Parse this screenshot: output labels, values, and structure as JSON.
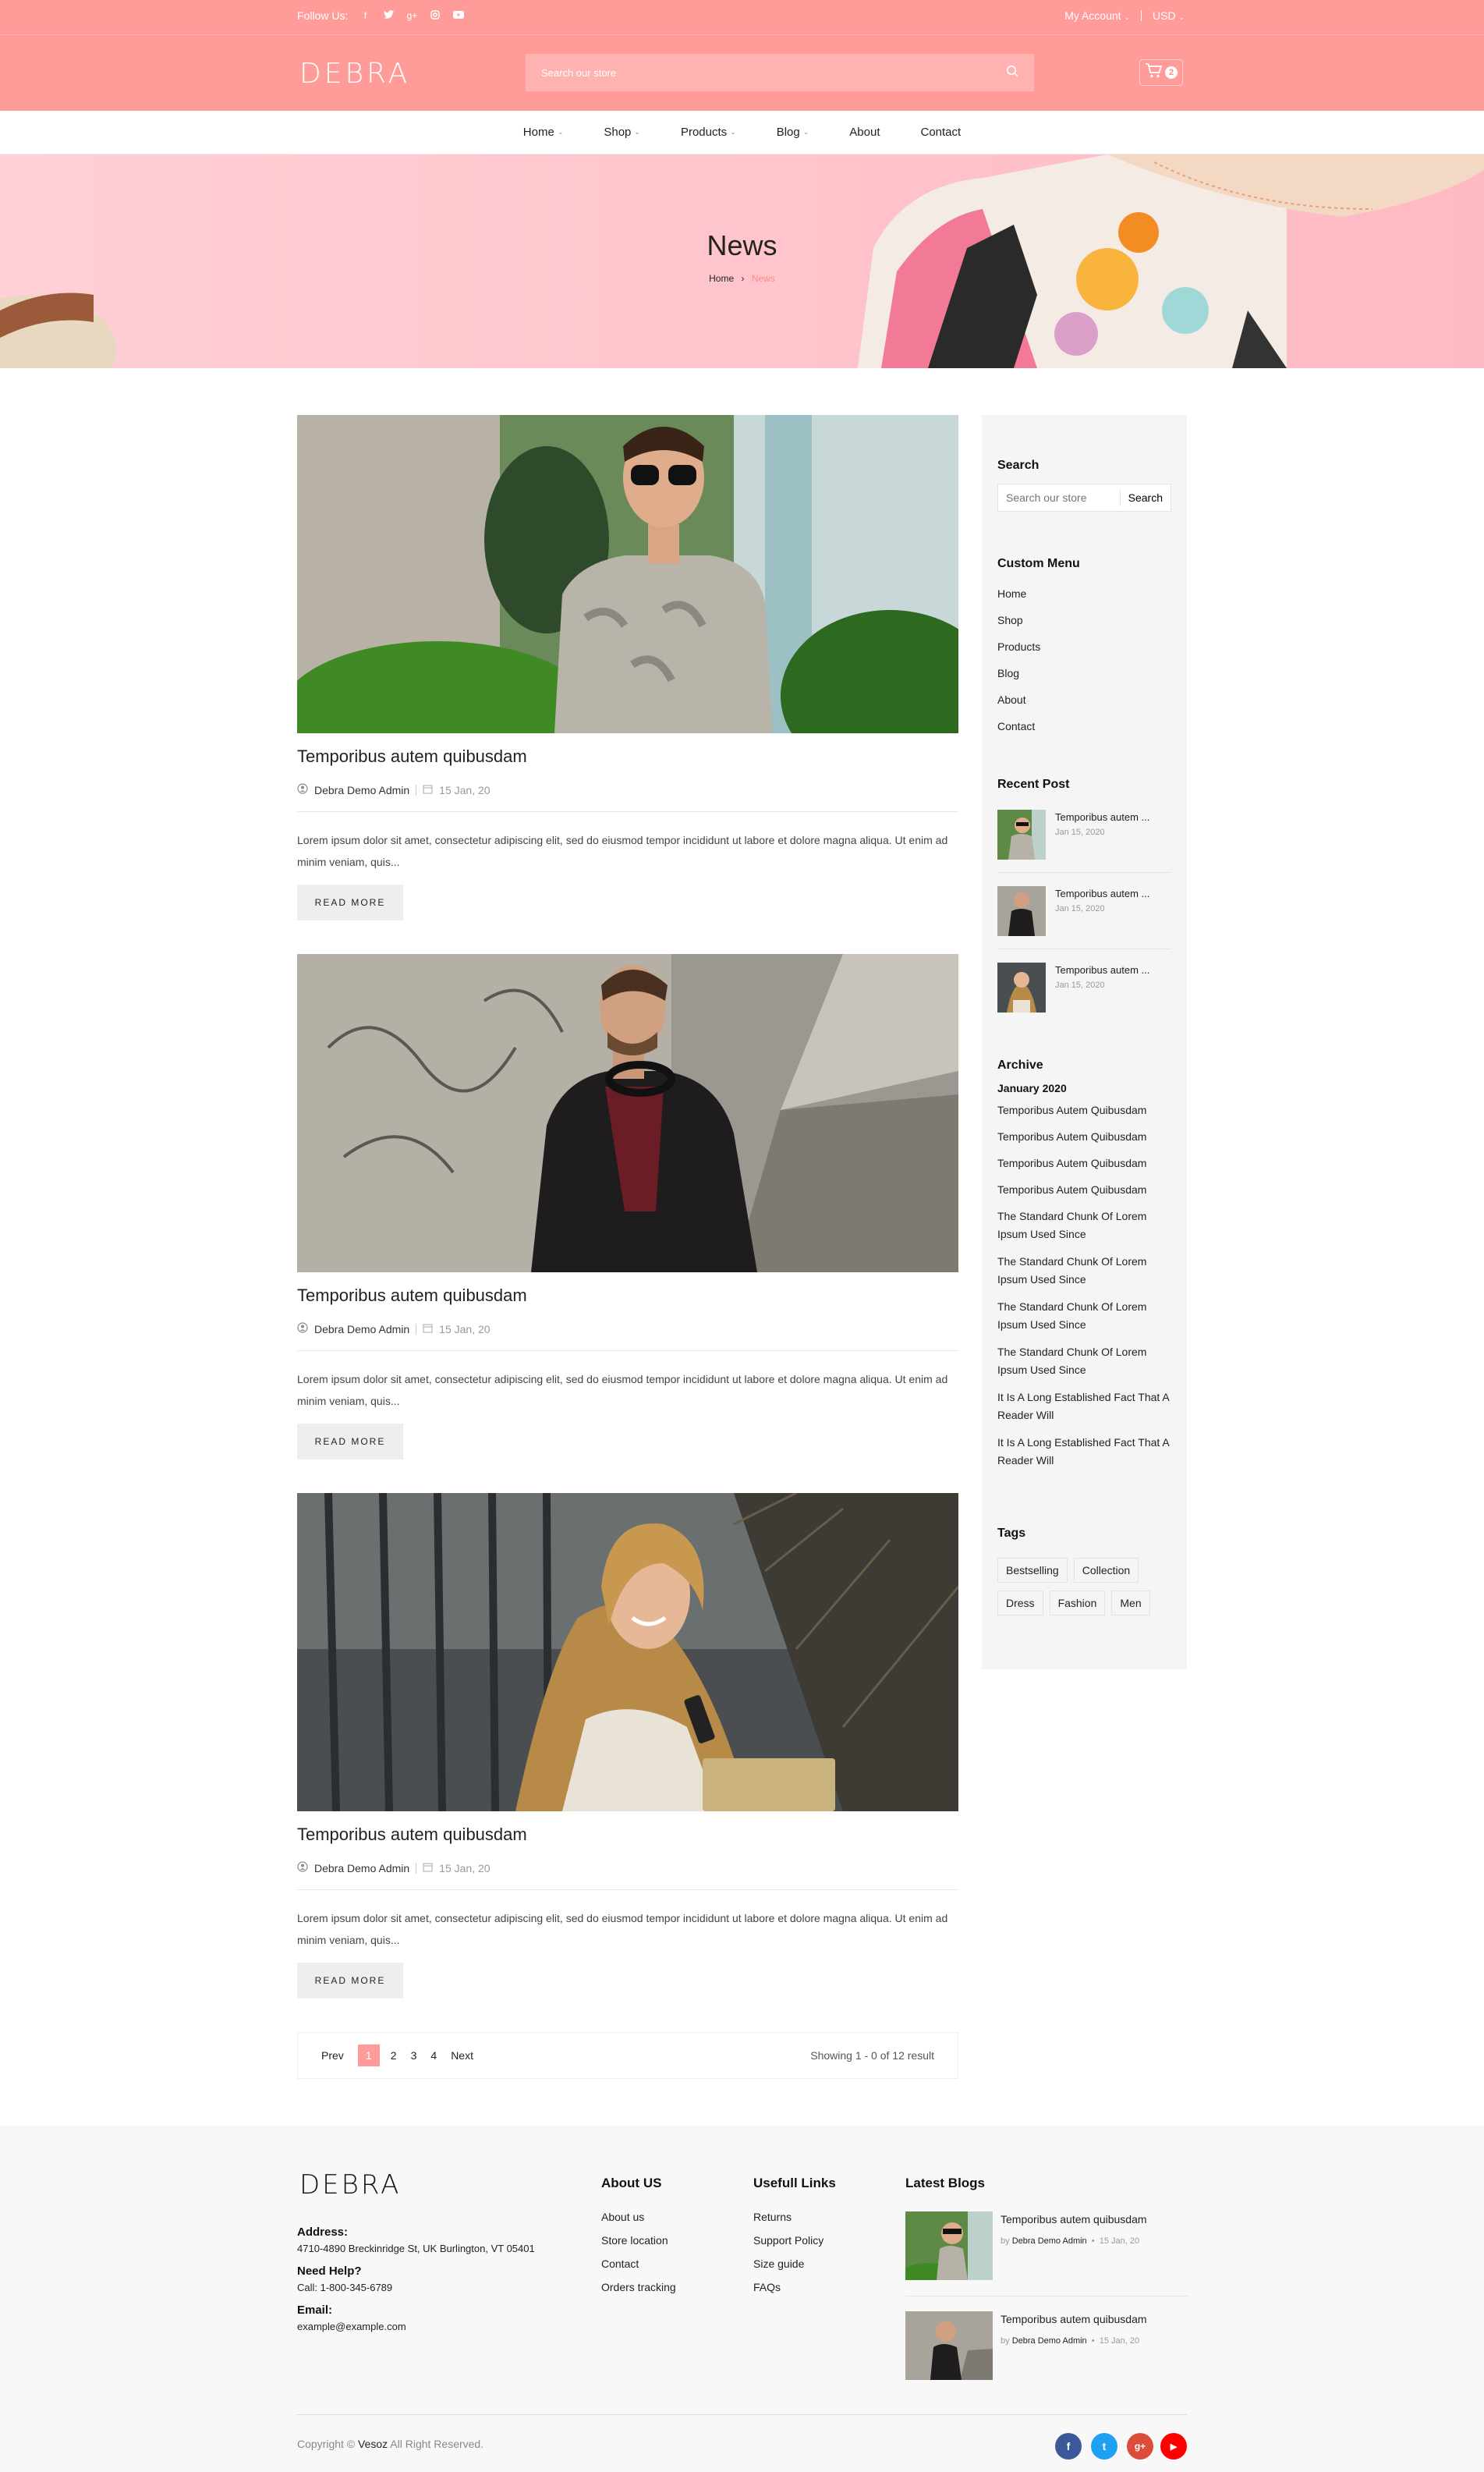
{
  "topbar": {
    "follow_label": "Follow Us:",
    "social_icons": [
      "facebook-icon",
      "twitter-icon",
      "google-plus-icon",
      "instagram-icon",
      "youtube-icon"
    ],
    "account": "My Account",
    "currency": "USD"
  },
  "header": {
    "logo": "DEBRA",
    "search_placeholder": "Search our store",
    "cart_count": "2"
  },
  "nav": {
    "items": [
      {
        "label": "Home",
        "dropdown": true
      },
      {
        "label": "Shop",
        "dropdown": true
      },
      {
        "label": "Products",
        "dropdown": true
      },
      {
        "label": "Blog",
        "dropdown": true
      },
      {
        "label": "About",
        "dropdown": false
      },
      {
        "label": "Contact",
        "dropdown": false
      }
    ]
  },
  "hero": {
    "title": "News",
    "breadcrumb_home": "Home",
    "breadcrumb_sep": "›",
    "breadcrumb_current": "News"
  },
  "posts": [
    {
      "title": "Temporibus autem quibusdam",
      "author": "Debra Demo Admin",
      "date": "15 Jan, 20",
      "excerpt": "Lorem ipsum dolor sit amet, consectetur adipiscing elit, sed do eiusmod tempor incididunt ut labore et dolore magna aliqua. Ut enim ad minim veniam, quis...",
      "button": "READ MORE"
    },
    {
      "title": "Temporibus autem quibusdam",
      "author": "Debra Demo Admin",
      "date": "15 Jan, 20",
      "excerpt": "Lorem ipsum dolor sit amet, consectetur adipiscing elit, sed do eiusmod tempor incididunt ut labore et dolore magna aliqua. Ut enim ad minim veniam, quis...",
      "button": "READ MORE"
    },
    {
      "title": "Temporibus autem quibusdam",
      "author": "Debra Demo Admin",
      "date": "15 Jan, 20",
      "excerpt": "Lorem ipsum dolor sit amet, consectetur adipiscing elit, sed do eiusmod tempor incididunt ut labore et dolore magna aliqua. Ut enim ad minim veniam, quis...",
      "button": "READ MORE"
    }
  ],
  "pagination": {
    "prev": "Prev",
    "pages": [
      "1",
      "2",
      "3",
      "4"
    ],
    "active": "1",
    "next": "Next",
    "showing": "Showing 1 - 0 of 12 result"
  },
  "sidebar": {
    "search_title": "Search",
    "search_placeholder": "Search our store",
    "search_button": "Search",
    "menu_title": "Custom Menu",
    "menu": [
      "Home",
      "Shop",
      "Products",
      "Blog",
      "About",
      "Contact"
    ],
    "recent_title": "Recent Post",
    "recent": [
      {
        "title": "Temporibus autem ...",
        "date": "Jan 15, 2020"
      },
      {
        "title": "Temporibus autem ...",
        "date": "Jan 15, 2020"
      },
      {
        "title": "Temporibus autem ...",
        "date": "Jan 15, 2020"
      }
    ],
    "archive_title": "Archive",
    "archive_month": "January 2020",
    "archive": [
      "Temporibus Autem Quibusdam",
      "Temporibus Autem Quibusdam",
      "Temporibus Autem Quibusdam",
      "Temporibus Autem Quibusdam",
      "The Standard Chunk Of Lorem Ipsum Used Since",
      "The Standard Chunk Of Lorem Ipsum Used Since",
      "The Standard Chunk Of Lorem Ipsum Used Since",
      "The Standard Chunk Of Lorem Ipsum Used Since",
      "It Is A Long Established Fact That A Reader Will",
      "It Is A Long Established Fact That A Reader Will"
    ],
    "tags_title": "Tags",
    "tags": [
      "Bestselling",
      "Collection",
      "Dress",
      "Fashion",
      "Men"
    ]
  },
  "footer": {
    "logo": "DEBRA",
    "address_label": "Address:",
    "address": "4710-4890 Breckinridge St, UK Burlington, VT 05401",
    "help_label": "Need Help?",
    "help": "Call: 1-800-345-6789",
    "email_label": "Email:",
    "email": "example@example.com",
    "about_title": "About US",
    "about_links": [
      "About us",
      "Store location",
      "Contact",
      "Orders tracking"
    ],
    "useful_title": "Usefull Links",
    "useful_links": [
      "Returns",
      "Support Policy",
      "Size guide",
      "FAQs"
    ],
    "blogs_title": "Latest Blogs",
    "blogs": [
      {
        "title": "Temporibus autem quibusdam",
        "by": "by",
        "author": "Debra Demo Admin",
        "date": "15 Jan, 20"
      },
      {
        "title": "Temporibus autem quibusdam",
        "by": "by",
        "author": "Debra Demo Admin",
        "date": "15 Jan, 20"
      }
    ],
    "copyright_pre": "Copyright ©",
    "copyright_brand": "Vesoz",
    "copyright_post": "All Right Reserved.",
    "social": [
      {
        "icon": "facebook-icon",
        "glyph": "f",
        "color": "#3b5998"
      },
      {
        "icon": "twitter-icon",
        "glyph": "t",
        "color": "#1da1f2"
      },
      {
        "icon": "google-plus-icon",
        "glyph": "g+",
        "color": "#dd4b39"
      },
      {
        "icon": "youtube-icon",
        "glyph": "▶",
        "color": "#ff0000"
      }
    ]
  },
  "colors": {
    "accent": "#ff9c9a",
    "hero_bg": "#ffc0c8"
  }
}
